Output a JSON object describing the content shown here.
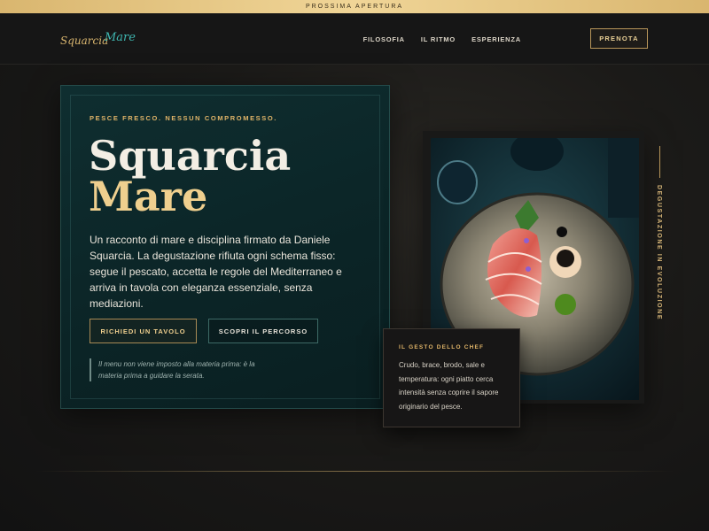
{
  "announcement": "PROSSIMA APERTURA",
  "brand": {
    "logo_part1": "Squarcia",
    "logo_part2": "Mare"
  },
  "nav": {
    "items": [
      "FILOSOFIA",
      "IL RITMO",
      "ESPERIENZA"
    ],
    "cta": "PRENOTA"
  },
  "hero": {
    "eyebrow": "PESCE FRESCO. NESSUN COMPROMESSO.",
    "title_line1": "Squarcia",
    "title_line2": "Mare",
    "lead": "Un racconto di mare e disciplina firmato da Daniele Squarcia. La degustazione rifiuta ogni schema fisso: segue il pescato, accetta le regole del Mediterraneo e arriva in tavola con eleganza essenziale, senza mediazioni.",
    "primary_button": "RICHIEDI UN TAVOLO",
    "secondary_button": "SCOPRI IL PERCORSO",
    "quote": "Il menu non viene imposto alla materia prima: è la materia prima a guidare la serata."
  },
  "side_label": "DEGUSTAZIONE IN EVOLUZIONE",
  "chef_card": {
    "heading": "IL GESTO DELLO CHEF",
    "text": "Crudo, brace, brodo, sale e temperatura: ogni piatto cerca intensità senza coprire il sapore originario del pesce."
  },
  "colors": {
    "accent_gold": "#e0b468",
    "card_teal": "#0f2e30",
    "background": "#161616"
  }
}
